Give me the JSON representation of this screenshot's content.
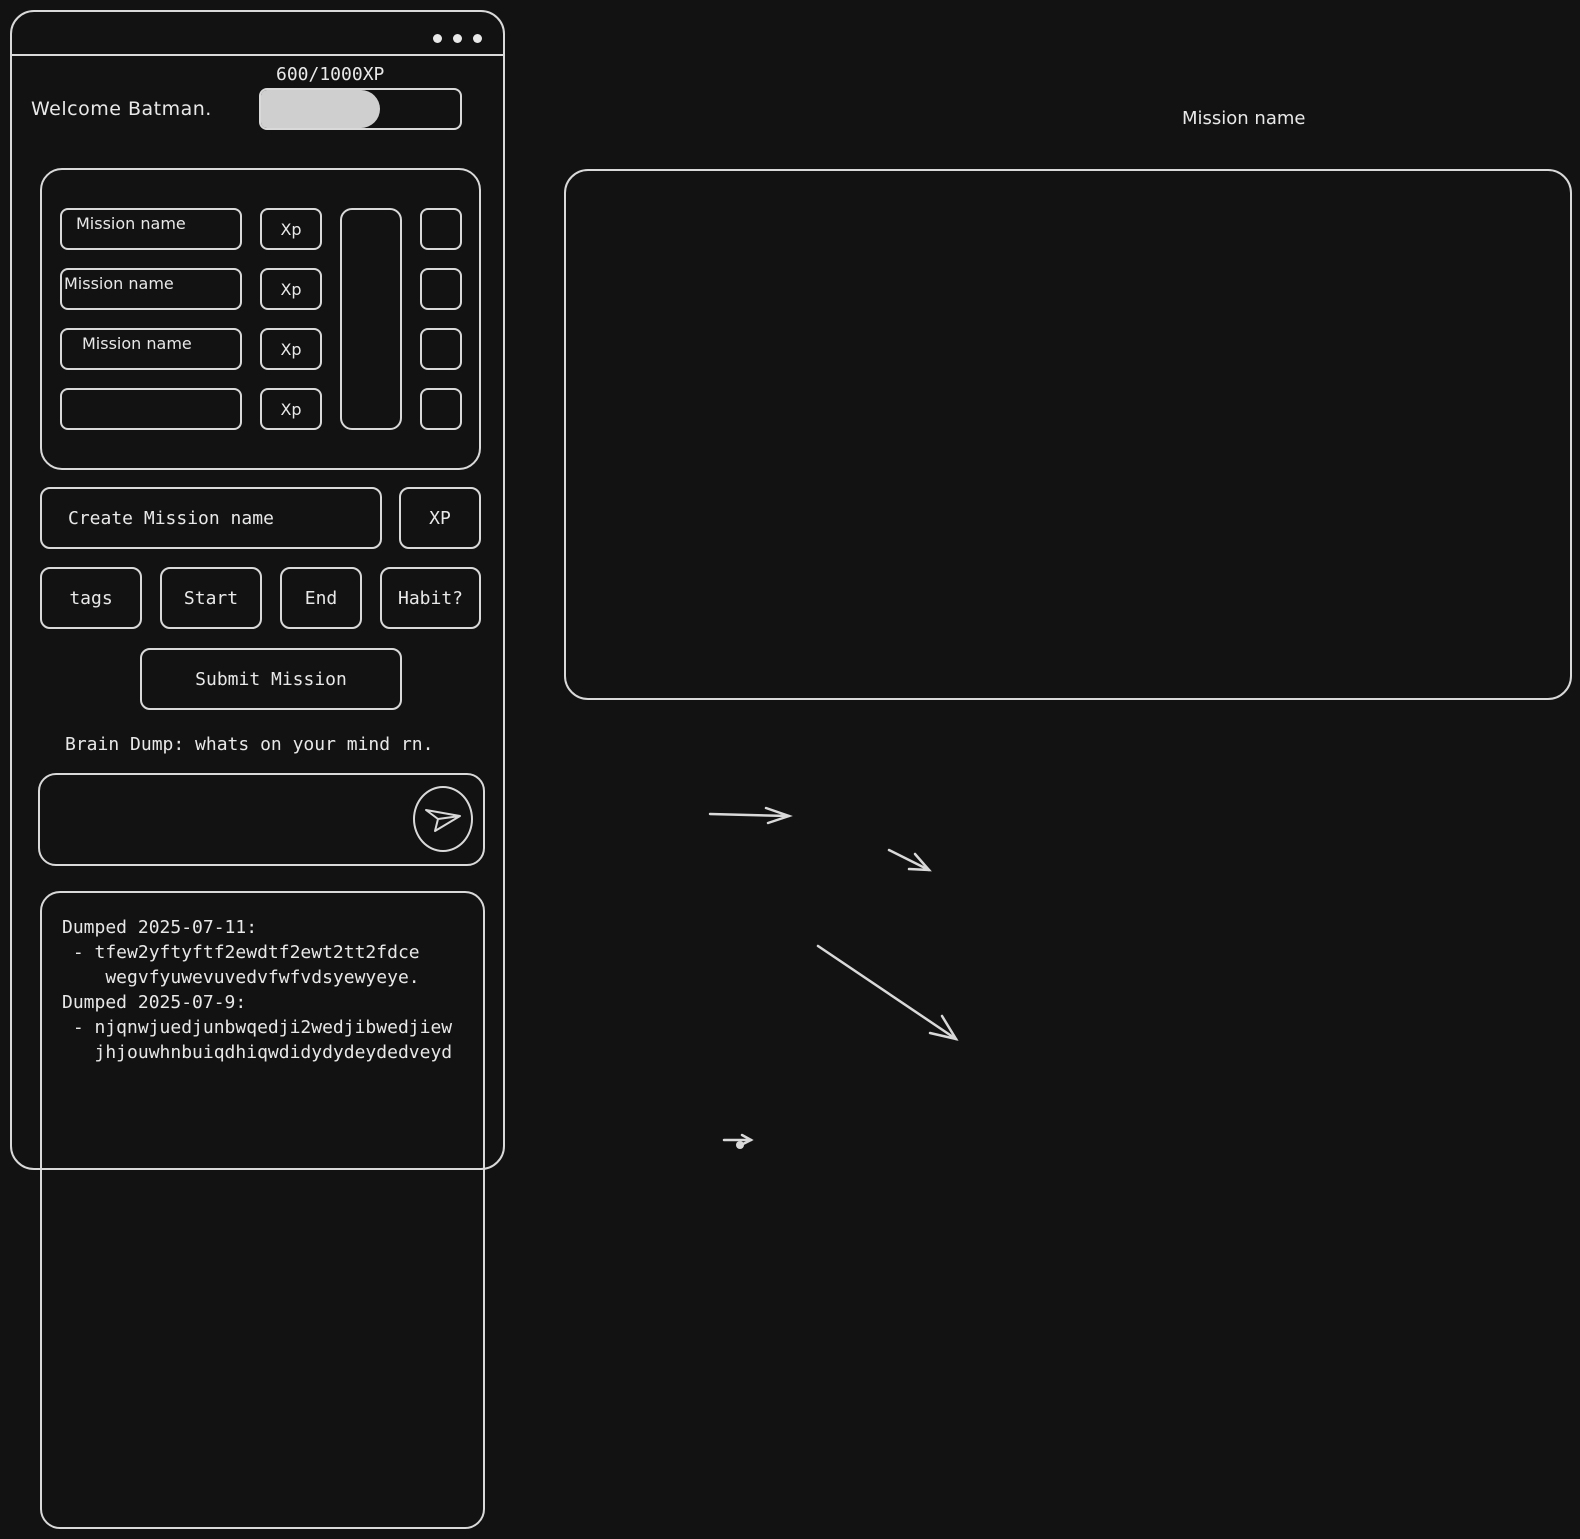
{
  "header": {
    "welcome": "Welcome Batman.",
    "xp_label": "600/1000XP",
    "xp_progress": 0.6
  },
  "missions": {
    "rows": [
      {
        "name": "Mission name",
        "xp": "Xp"
      },
      {
        "name": "Mission name",
        "xp": "Xp"
      },
      {
        "name": "Mission name",
        "xp": "Xp"
      },
      {
        "name": "",
        "xp": "Xp"
      }
    ]
  },
  "create": {
    "name_placeholder": "Create Mission name",
    "xp_placeholder": "XP",
    "tags_label": "tags",
    "start_label": "Start",
    "end_label": "End",
    "habit_label": "Habit?",
    "submit_label": "Submit Mission"
  },
  "braindump": {
    "label": "Brain Dump: whats on your mind rn.",
    "send_icon": "send-icon"
  },
  "history": {
    "lines": [
      "Dumped 2025-07-11:",
      " - tfew2yftyftf2ewdtf2ewt2tt2fdce",
      "    wegvfyuwevuvedvfwfvdsyewyeye.",
      "Dumped 2025-07-9:",
      " - njqnwjuedjunbwqedji2wedjibwedjiew",
      "   jhjouwhnbuiqdhiqwdidydydeydedveyd"
    ]
  },
  "detail": {
    "title": "Mission name"
  },
  "colors": {
    "background": "#121212",
    "stroke": "#d9d9d9",
    "fill": "#cfcfcf"
  }
}
